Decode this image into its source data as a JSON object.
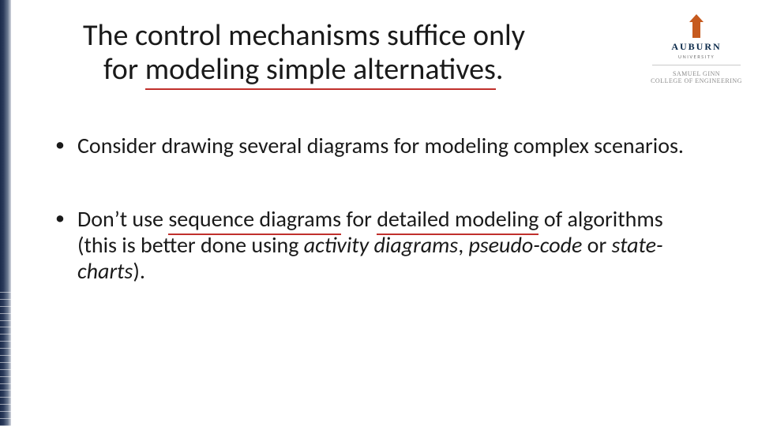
{
  "logo": {
    "word": "AUBURN",
    "sub": "UNIVERSITY",
    "ginn_line1": "SAMUEL GINN",
    "ginn_line2": "COLLEGE OF ENGINEERING"
  },
  "title": {
    "line1": "The control mechanisms suffice only",
    "line2_pre": "for ",
    "line2_underlined": "modeling simple alternatives",
    "line2_post": "."
  },
  "bullets": [
    {
      "text": "Consider drawing several diagrams for modeling complex scenarios."
    },
    {
      "pre": "Don’t use ",
      "seq_u": "sequence diagrams",
      "mid1": " for ",
      "det_u": "detailed modeling",
      "mid2": " of algorithms (this is better done using ",
      "it1": "activity diagrams",
      "sep1": ", ",
      "it2": "pseudo-code",
      "sep2": " or ",
      "it3": "state-charts",
      "post": ")."
    }
  ]
}
